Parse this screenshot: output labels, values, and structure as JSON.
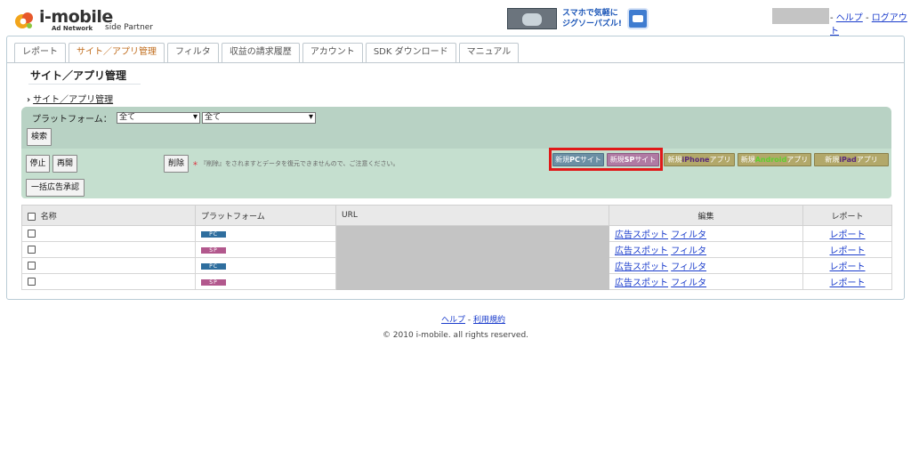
{
  "header": {
    "logo_text": "i-mobile",
    "logo_sub": "Ad Network",
    "logo_partner": "side Partner",
    "banner_line1": "スマホで気軽に",
    "banner_line2": "ジグソーパズル!",
    "help_link": "ヘルプ",
    "logout_link": "ログアウト",
    "separator": "-"
  },
  "tabs": [
    {
      "label": "レポート",
      "active": false
    },
    {
      "label": "サイト／アプリ管理",
      "active": true
    },
    {
      "label": "フィルタ",
      "active": false
    },
    {
      "label": "収益の請求履歴",
      "active": false
    },
    {
      "label": "アカウント",
      "active": false
    },
    {
      "label": "SDK ダウンロード",
      "active": false
    },
    {
      "label": "マニュアル",
      "active": false
    }
  ],
  "page": {
    "title": "サイト／アプリ管理",
    "breadcrumb": "サイト／アプリ管理"
  },
  "filter": {
    "label": "プラットフォーム：",
    "select1": "全て",
    "select2": "全て",
    "search_button": "検索"
  },
  "actions": {
    "stop": "停止",
    "resume": "再開",
    "delete": "削除",
    "warning": "『削除』をされますとデータを復元できませんので、ご注意ください。",
    "bulk_approve": "一括広告承認",
    "new_pc": {
      "prefix": "新規",
      "bold": "PC",
      "suffix": "サイト"
    },
    "new_sp": {
      "prefix": "新規",
      "bold": "SP",
      "suffix": "サイト"
    },
    "new_iphone": {
      "prefix": "新規",
      "bold": "iPhone",
      "suffix": "アプリ"
    },
    "new_android": {
      "prefix": "新規",
      "bold": "Android",
      "suffix": "アプリ"
    },
    "new_ipad": {
      "prefix": "新規",
      "bold": "iPad",
      "suffix": "アプリ"
    }
  },
  "table": {
    "headers": {
      "name": "名称",
      "platform": "プラットフォーム",
      "url": "URL",
      "edit": "編集",
      "report": "レポート"
    },
    "rows": [
      {
        "platform": "PC",
        "ad_spot": "広告スポット",
        "filter": "フィルタ",
        "report": "レポート"
      },
      {
        "platform": "SP",
        "ad_spot": "広告スポット",
        "filter": "フィルタ",
        "report": "レポート"
      },
      {
        "platform": "PC",
        "ad_spot": "広告スポット",
        "filter": "フィルタ",
        "report": "レポート"
      },
      {
        "platform": "SP",
        "ad_spot": "広告スポット",
        "filter": "フィルタ",
        "report": "レポート"
      }
    ]
  },
  "footer": {
    "help": "ヘルプ",
    "separator": "-",
    "terms": "利用規約",
    "copyright": "© 2010 i-mobile. all rights reserved."
  },
  "colors": {
    "accent_orange": "#c06c1c",
    "link_blue": "#1a3ccc",
    "filter_green": "#b8d2c4",
    "action_green": "#c5dfcf",
    "highlight_red": "#e01818",
    "pc_badge": "#2f6e9e",
    "sp_badge": "#b2588d"
  }
}
